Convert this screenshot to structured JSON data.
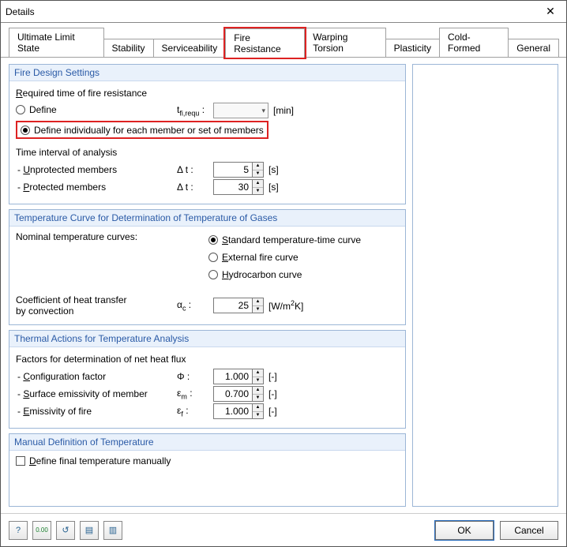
{
  "window": {
    "title": "Details"
  },
  "tabs": {
    "t0": "Ultimate Limit State",
    "t1": "Stability",
    "t2": "Serviceability",
    "t3": "Fire Resistance",
    "t4": "Warping Torsion",
    "t5": "Plasticity",
    "t6": "Cold-Formed",
    "t7": "General"
  },
  "fds": {
    "header": "Fire Design Settings",
    "req_label": "Required time of fire resistance",
    "define_label": "Define",
    "tfi_sym": "t",
    "tfi_sub": "fi,requ",
    "tfi_unit": "[min]",
    "define_ind": "Define individually for each member or set of members",
    "ti_label": "Time interval of analysis",
    "unprot": "nprotected members",
    "prot": "rotected members",
    "dt_sym": "Δ t :",
    "unprot_val": "5",
    "prot_val": "30",
    "s_unit": "[s]"
  },
  "tcurve": {
    "header": "Temperature Curve for Determination of Temperature of Gases",
    "nom_label": "Nominal temperature curves:",
    "opt_std": "tandard temperature-time curve",
    "opt_ext": "xternal fire curve",
    "opt_hyd": "ydrocarbon curve",
    "coef_l1": "Coefficient of heat transfer",
    "coef_l2": "by convection",
    "ac_sym": "α",
    "ac_sub": "c",
    "ac_val": "25",
    "ac_unit_pre": "[W/m",
    "ac_unit_sup": "2",
    "ac_unit_post": "K]"
  },
  "therm": {
    "header": "Thermal Actions for Temperature Analysis",
    "factors": "Factors for determination of net heat flux",
    "conf": "onfiguration factor",
    "conf_sym": "Φ :",
    "conf_val": "1.000",
    "emis_m": "urface emissivity of member",
    "em_sym": "ε",
    "em_sub": "m",
    "em_val": "0.700",
    "emis_f": "missivity of fire",
    "ef_sym": "ε",
    "ef_sub": "f",
    "ef_val": "1.000",
    "dim_unit": "[-]"
  },
  "manual": {
    "header": "Manual Definition of Temperature",
    "chk": "efine final temperature manually"
  },
  "footer": {
    "ok": "OK",
    "cancel": "Cancel"
  },
  "icons": {
    "help": "?",
    "num": "0.00",
    "reset": "↺",
    "i4": "▤",
    "i5": "▥"
  }
}
